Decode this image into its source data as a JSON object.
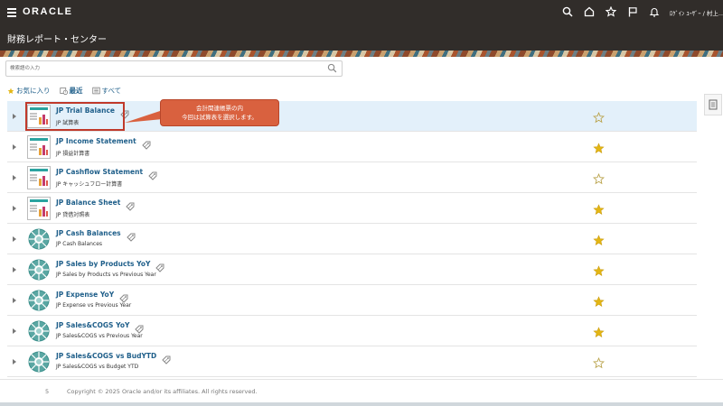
{
  "header": {
    "logo": "ORACLE",
    "user": "ﾛｸﾞｲﾝ ﾕｰｻﾞｰ / 村上..."
  },
  "title": "財務レポート・センター",
  "search": {
    "placeholder": "検索語の入力"
  },
  "filters": [
    {
      "label": "お気に入り",
      "icon": "star-icon"
    },
    {
      "label": "最近",
      "icon": "recent-icon"
    },
    {
      "label": "すべて",
      "icon": "list-icon"
    }
  ],
  "reports": [
    {
      "name": "JP Trial Balance",
      "desc": "JP 試算表",
      "type": "report",
      "favorite": false
    },
    {
      "name": "JP Income Statement",
      "desc": "JP 損益計算書",
      "type": "report",
      "favorite": true
    },
    {
      "name": "JP Cashflow Statement",
      "desc": "JP キャッシュフロー計算書",
      "type": "report",
      "favorite": false
    },
    {
      "name": "JP Balance Sheet",
      "desc": "JP 貸借対照表",
      "type": "report",
      "favorite": true
    },
    {
      "name": "JP Cash Balances",
      "desc": "JP Cash Balances",
      "type": "dashboard",
      "favorite": true
    },
    {
      "name": "JP Sales by Products YoY",
      "desc": "JP Sales by Products vs Previous Year",
      "type": "dashboard",
      "favorite": true
    },
    {
      "name": "JP Expense YoY",
      "desc": "JP Expense vs Previous Year",
      "type": "dashboard",
      "favorite": true
    },
    {
      "name": "JP Sales&COGS YoY",
      "desc": "JP Sales&COGS vs Previous Year",
      "type": "dashboard",
      "favorite": true
    },
    {
      "name": "JP Sales&COGS vs BudYTD",
      "desc": "JP Sales&COGS vs Budget YTD",
      "type": "dashboard",
      "favorite": false
    }
  ],
  "callout": {
    "line1": "会計関連帳票の内",
    "line2": "今回は試算表を選択します。"
  },
  "footer": {
    "page": "5",
    "copyright": "Copyright © 2025 Oracle and/or its affiliates. All rights reserved."
  },
  "colors": {
    "header_bg": "#312d2a",
    "link": "#1f5f8a",
    "star": "#e3b614",
    "callout": "#d9613f"
  }
}
